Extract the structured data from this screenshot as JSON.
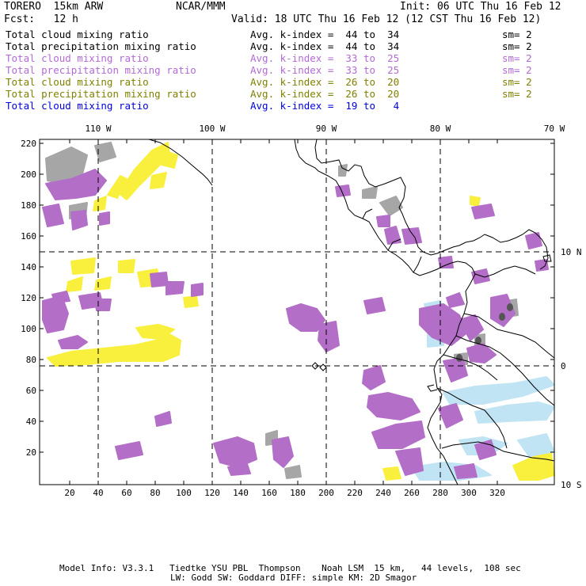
{
  "header": {
    "model": "TORERO  15km ARW",
    "org": "NCAR/MMM",
    "init": "Init: 06 UTC Thu 16 Feb 12",
    "fcst": "Fcst:   12 h",
    "valid": "Valid: 18 UTC Thu 16 Feb 12 (12 CST Thu 16 Feb 12)"
  },
  "legend": [
    {
      "field": "Total cloud mixing ratio",
      "kindex": "Avg. k-index =  44 to  34",
      "sm": "sm= 2",
      "color": "#000000"
    },
    {
      "field": "Total precipitation mixing ratio",
      "kindex": "Avg. k-index =  44 to  34",
      "sm": "sm= 2",
      "color": "#000000"
    },
    {
      "field": "Total cloud mixing ratio",
      "kindex": "Avg. k-index =  33 to  25",
      "sm": "sm= 2",
      "color": "#b36ad6"
    },
    {
      "field": "Total precipitation mixing ratio",
      "kindex": "Avg. k-index =  33 to  25",
      "sm": "sm= 2",
      "color": "#b36ad6"
    },
    {
      "field": "Total cloud mixing ratio",
      "kindex": "Avg. k-index =  26 to  20",
      "sm": "sm= 2",
      "color": "#808000"
    },
    {
      "field": "Total precipitation mixing ratio",
      "kindex": "Avg. k-index =  26 to  20",
      "sm": "sm= 2",
      "color": "#808000"
    },
    {
      "field": "Total cloud mixing ratio",
      "kindex": "Avg. k-index =  19 to   4",
      "sm": "",
      "color": "#0000e0"
    }
  ],
  "map": {
    "top_lon_labels": [
      "110 W",
      "100 W",
      "90 W",
      "80 W",
      "70 W"
    ],
    "right_lat_labels": [
      "10 N",
      "0",
      "10 S"
    ],
    "y_ticks": [
      "220",
      "200",
      "180",
      "160",
      "140",
      "120",
      "100",
      "80",
      "60",
      "40",
      "20"
    ],
    "x_ticks": [
      "20",
      "40",
      "60",
      "80",
      "100",
      "120",
      "140",
      "160",
      "180",
      "200",
      "220",
      "240",
      "260",
      "280",
      "300",
      "320"
    ],
    "colors": {
      "purple": "#b36ec8",
      "yellow": "#f8f03c",
      "gray": "#a6a6a6",
      "lightblue": "#c0e4f4",
      "dark": "#555555"
    }
  },
  "footer": {
    "line1": "Model Info: V3.3.1   Tiedtke YSU PBL  Thompson    Noah LSM  15 km,   44 levels,  108 sec",
    "line2": "LW: Godd SW: Goddard DIFF: simple KM: 2D Smagor"
  }
}
